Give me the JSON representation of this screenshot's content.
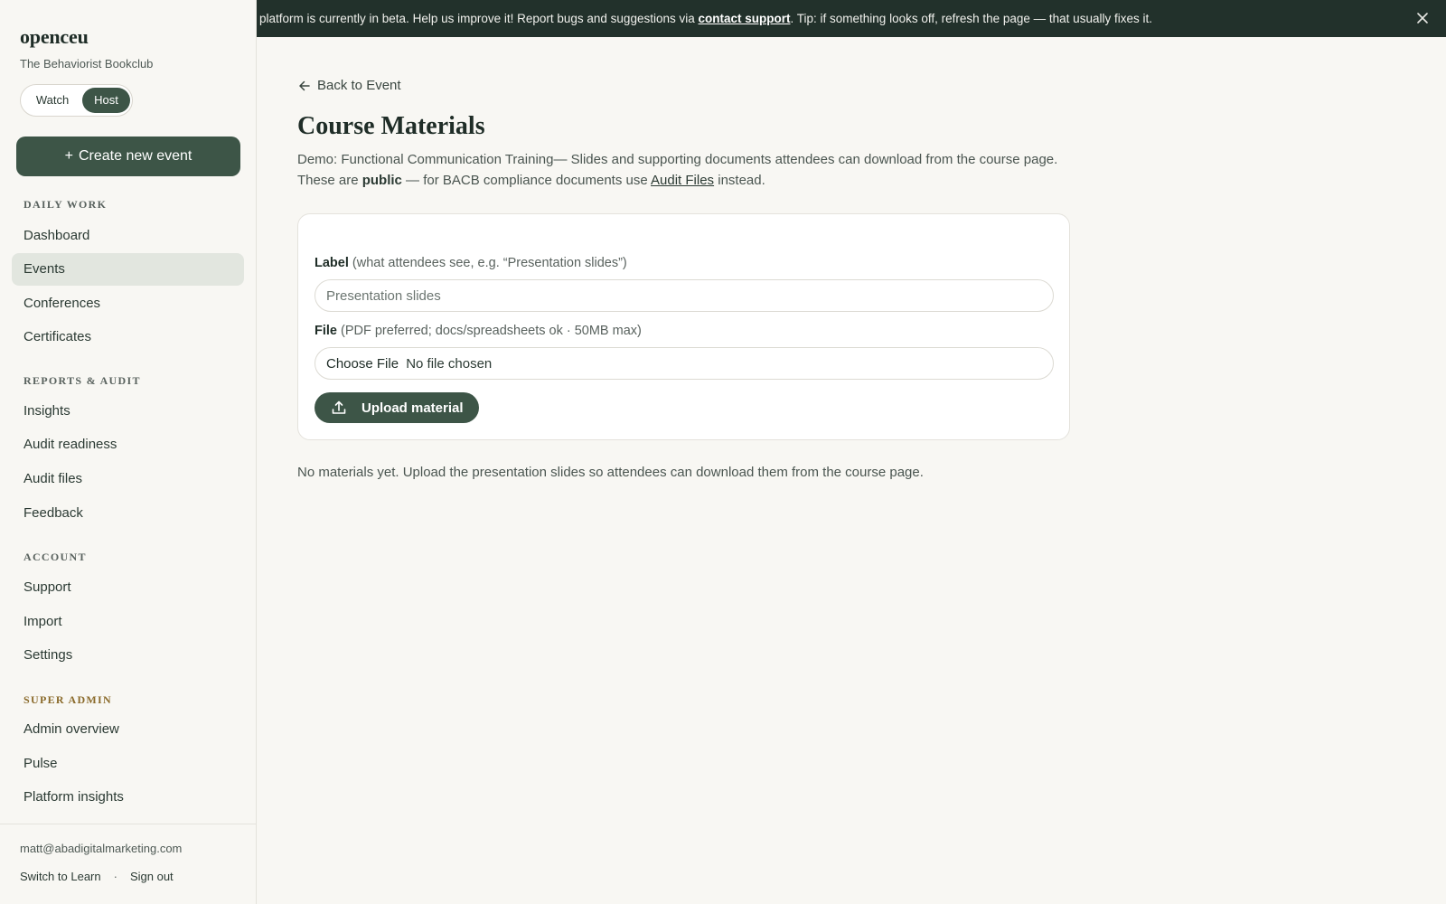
{
  "sidebar": {
    "brand": "openceu",
    "org_name": "The Behaviorist Bookclub",
    "mode_toggle": {
      "watch_label": "Watch",
      "host_label": "Host",
      "selected": "Host"
    },
    "create_button": "Create new event",
    "sections": [
      {
        "title": "DAILY WORK",
        "items": [
          "Dashboard",
          "Events",
          "Conferences",
          "Certificates"
        ]
      },
      {
        "title": "REPORTS & AUDIT",
        "items": [
          "Insights",
          "Audit readiness",
          "Audit files",
          "Feedback"
        ]
      },
      {
        "title": "ACCOUNT",
        "items": [
          "Support",
          "Import",
          "Settings"
        ]
      },
      {
        "title": "SUPER ADMIN",
        "items": [
          "Admin overview",
          "Pulse",
          "Platform insights"
        ]
      }
    ],
    "active_item": "Events",
    "user_email": "matt@abadigitalmarketing.com",
    "switch_label": "Switch to Learn",
    "signout_label": "Sign out"
  },
  "banner": {
    "text_before": "platform is currently in beta. Help us improve it! Report bugs and suggestions via ",
    "link": "contact support",
    "text_after": ". Tip: if something looks off, refresh the page — that usually fixes it."
  },
  "main": {
    "back_link": "Back to Event",
    "title": "Course Materials",
    "intro_part1": "Demo: Functional Communication Training— Slides and supporting documents attendees can download from the course page. These are ",
    "intro_bold": "public",
    "intro_part2": " — for BACB compliance documents use ",
    "intro_link": "Audit Files",
    "intro_part3": " instead.",
    "form": {
      "label_title": "Label",
      "label_hint": "(what attendees see, e.g. “Presentation slides”)",
      "label_placeholder": "Presentation slides",
      "file_title": "File",
      "file_hint": "(PDF preferred; docs/spreadsheets ok · 50MB max)",
      "file_button": "Choose File",
      "file_status": "No file chosen",
      "upload_button": "Upload material"
    },
    "empty_note": "No materials yet. Upload the presentation slides so attendees can download them from the course page."
  }
}
